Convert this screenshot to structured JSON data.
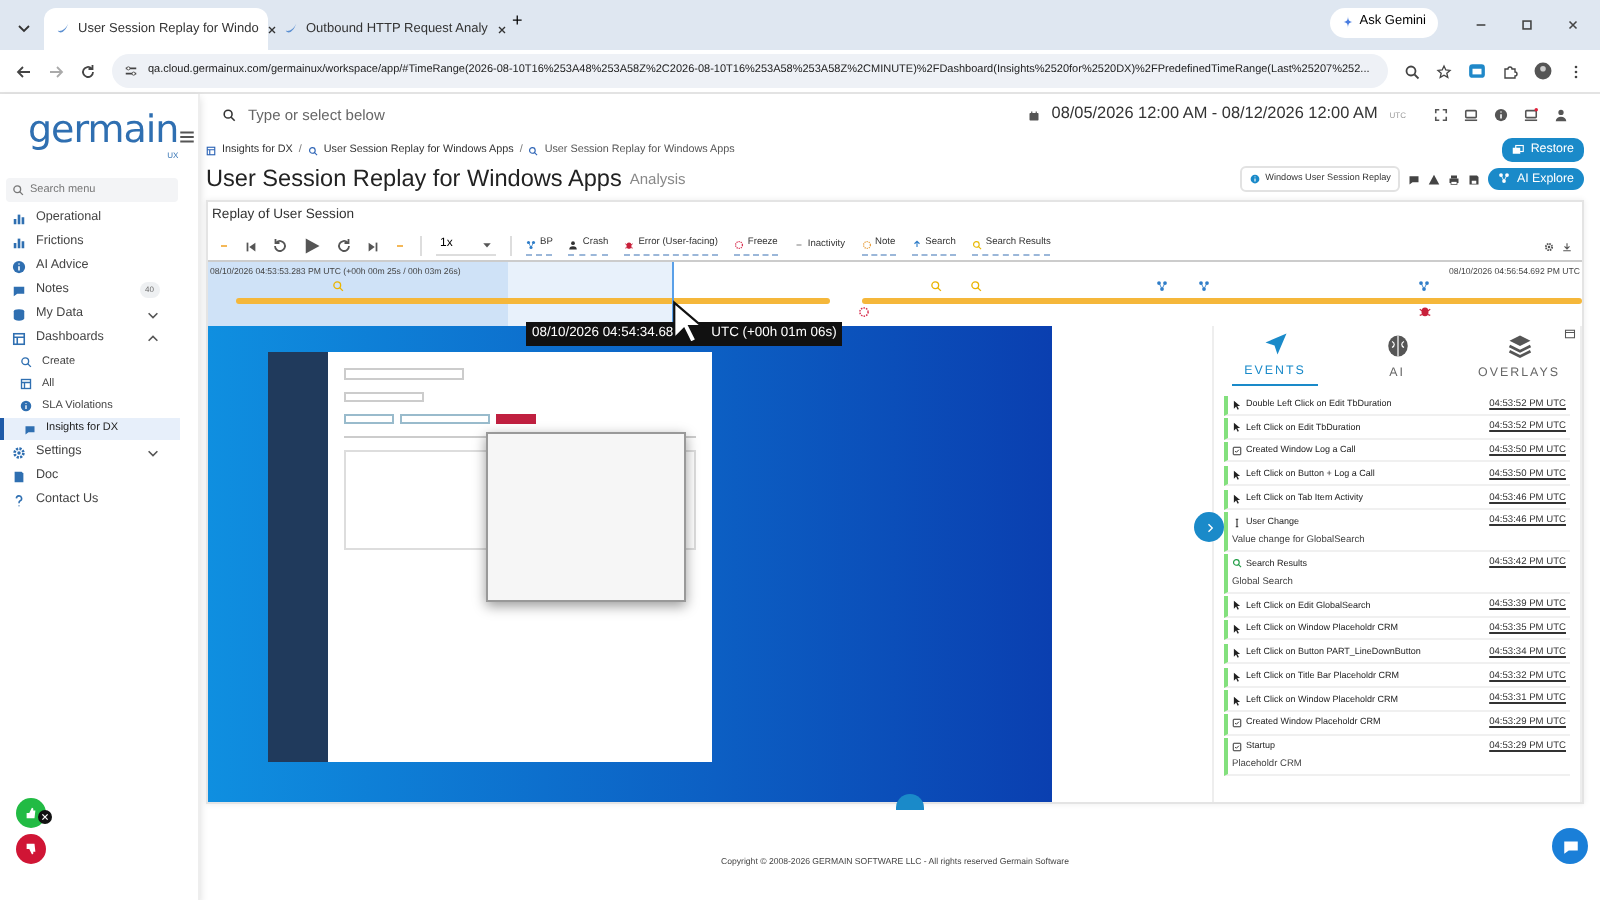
{
  "browser": {
    "tabs": [
      {
        "title": "User Session Replay for Windo",
        "selected": true
      },
      {
        "title": "Outbound HTTP Request Analy",
        "selected": false
      }
    ],
    "new_tab": "+",
    "ask_button": "Ask Gemini",
    "url": "qa.cloud.germainux.com/germainux/workspace/app/#TimeRange(2026-08-10T16%253A48%253A58Z%2C2026-08-10T16%253A58%253A58Z%2CMINUTE)%2FDashboard(Insights%2520for%2520DX)%2FPredefinedTimeRange(Last%25207%252..."
  },
  "sidebar": {
    "logo": "germain",
    "logo_sub": "UX",
    "search_placeholder": "Search menu",
    "items": [
      {
        "label": "Operational",
        "selected": false
      },
      {
        "label": "Frictions",
        "selected": false
      },
      {
        "label": "AI Advice",
        "selected": false
      },
      {
        "label": "Notes",
        "selected": false,
        "badge": "40"
      },
      {
        "label": "My Data",
        "selected": false,
        "expanded": false
      },
      {
        "label": "Dashboards",
        "selected": false,
        "expanded": true,
        "children": [
          {
            "label": "Create",
            "selected": false
          },
          {
            "label": "All",
            "selected": false
          },
          {
            "label": "SLA Violations",
            "selected": false
          },
          {
            "label": "Insights for DX",
            "selected": true
          }
        ]
      },
      {
        "label": "Settings",
        "selected": false,
        "expanded": false
      },
      {
        "label": "Doc",
        "selected": false
      },
      {
        "label": "Contact Us",
        "selected": false
      }
    ]
  },
  "topbar": {
    "search_placeholder": "Type or select below",
    "date_range": "08/05/2026 12:00 AM - 08/12/2026 12:00 AM",
    "timezone": "UTC"
  },
  "breadcrumb": [
    {
      "label": "Insights for DX"
    },
    {
      "separator": "/",
      "label": "User Session Replay for Windows Apps"
    },
    {
      "separator": "/",
      "label": "User Session Replay for Windows Apps"
    }
  ],
  "restore_button": "Restore",
  "title": "User Session Replay for Windows Apps",
  "subtitle": "Analysis",
  "dashboard_chip": "Windows User Session Replay",
  "ai_button": "AI Explore",
  "panel": {
    "title": "Replay of User Session",
    "speed": "1x",
    "filters": [
      {
        "label": "BP",
        "kind": "bp",
        "selected": true
      },
      {
        "label": "Crash",
        "kind": "crash",
        "selected": true
      },
      {
        "label": "Error (User-facing)",
        "kind": "error",
        "selected": true
      },
      {
        "label": "Freeze",
        "kind": "freeze",
        "selected": true
      },
      {
        "label": "Inactivity",
        "kind": "inactivity",
        "selected": false
      },
      {
        "label": "Note",
        "kind": "note",
        "selected": true
      },
      {
        "label": "Search",
        "kind": "search",
        "selected": true
      },
      {
        "label": "Search Results",
        "kind": "results",
        "selected": true
      }
    ]
  },
  "timeline": {
    "start": "08/10/2026 04:53:53.283 PM UTC (+00h 00m 25s / 00h 03m 26s)",
    "end": "08/10/2026 04:56:54.692 PM UTC",
    "level": 0.338
  },
  "video": {
    "timestamp_left": "08/10/2026 04:54:34.68",
    "timestamp_right": "UTC (+00h 01m 06s)"
  },
  "events_panel": {
    "tabs": [
      {
        "label": "EVENTS",
        "selected": true
      },
      {
        "label": "AI",
        "selected": false
      },
      {
        "label": "OVERLAYS",
        "selected": false
      }
    ],
    "events": [
      {
        "kind": "click",
        "title": "Double Left Click on Edit TbDuration",
        "time": "04:53:52 PM UTC"
      },
      {
        "kind": "click",
        "title": "Left Click on Edit TbDuration",
        "time": "04:53:52 PM UTC"
      },
      {
        "kind": "window",
        "title": "Created Window Log a Call",
        "time": "04:53:50 PM UTC"
      },
      {
        "kind": "click",
        "title": "Left Click on Button + Log a Call",
        "time": "04:53:50 PM UTC"
      },
      {
        "kind": "click",
        "title": "Left Click on Tab Item Activity",
        "time": "04:53:46 PM UTC"
      },
      {
        "kind": "user",
        "title": "User Change",
        "detail": "Value change for GlobalSearch",
        "time": "04:53:46 PM UTC"
      },
      {
        "kind": "search",
        "title": "Search Results",
        "detail": "Global Search",
        "time": "04:53:42 PM UTC"
      },
      {
        "kind": "click",
        "title": "Left Click on Edit GlobalSearch",
        "time": "04:53:39 PM UTC"
      },
      {
        "kind": "click",
        "title": "Left Click on Window Placeholdr CRM",
        "time": "04:53:35 PM UTC"
      },
      {
        "kind": "click",
        "title": "Left Click on Button PART_LineDownButton",
        "time": "04:53:34 PM UTC"
      },
      {
        "kind": "click",
        "title": "Left Click on Title Bar Placeholdr CRM",
        "time": "04:53:32 PM UTC"
      },
      {
        "kind": "click",
        "title": "Left Click on Window Placeholdr CRM",
        "time": "04:53:31 PM UTC"
      },
      {
        "kind": "window",
        "title": "Created Window Placeholdr CRM",
        "time": "04:53:29 PM UTC"
      },
      {
        "kind": "window",
        "title": "Startup",
        "detail": "Placeholdr CRM",
        "time": "04:53:29 PM UTC"
      }
    ]
  },
  "footer": "Copyright © 2008-2026 GERMAIN SOFTWARE LLC - All rights reserved Germain Software"
}
